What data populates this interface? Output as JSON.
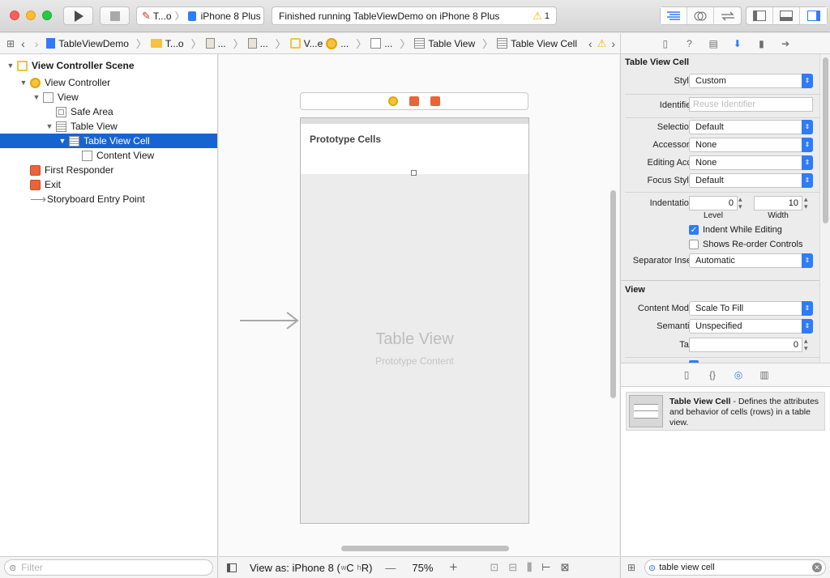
{
  "toolbar": {
    "scheme_target": "T...o",
    "scheme_device": "iPhone 8 Plus",
    "activity_text": "Finished running TableViewDemo on iPhone 8 Plus",
    "warning_count": "1"
  },
  "jumpbar": {
    "items": [
      "TableViewDemo",
      "T...o",
      "...",
      "...",
      "V...e",
      "...",
      "...",
      "Table View",
      "Table View Cell"
    ]
  },
  "navigator": {
    "scene": "View Controller Scene",
    "items": [
      {
        "label": "View Controller"
      },
      {
        "label": "View"
      },
      {
        "label": "Safe Area"
      },
      {
        "label": "Table View"
      },
      {
        "label": "Table View Cell"
      },
      {
        "label": "Content View"
      },
      {
        "label": "First Responder"
      },
      {
        "label": "Exit"
      },
      {
        "label": "Storyboard Entry Point"
      }
    ],
    "filter_placeholder": "Filter"
  },
  "canvas": {
    "prototype_cells": "Prototype Cells",
    "table_view_title": "Table View",
    "table_view_subtitle": "Prototype Content"
  },
  "canvas_bar": {
    "view_as": "View as: iPhone 8 (",
    "size_w": "w",
    "size_c": "C",
    "size_h": "h",
    "size_r": "R)",
    "minus": "—",
    "zoom": "75%",
    "plus": "+"
  },
  "inspector": {
    "cell_header": "Table View Cell",
    "style_label": "Style",
    "style_value": "Custom",
    "identifier_label": "Identifier",
    "identifier_placeholder": "Reuse Identifier",
    "selection_label": "Selection",
    "selection_value": "Default",
    "accessory_label": "Accessory",
    "accessory_value": "None",
    "editing_acc_label": "Editing Acc.",
    "editing_acc_value": "None",
    "focus_style_label": "Focus Style",
    "focus_style_value": "Default",
    "indentation_label": "Indentation",
    "indentation_level": "0",
    "indentation_width": "10",
    "level_label": "Level",
    "width_label": "Width",
    "indent_while_editing": "Indent While Editing",
    "indent_while_editing_checked": true,
    "shows_reorder": "Shows Re-order Controls",
    "shows_reorder_checked": false,
    "separator_inset_label": "Separator Inset",
    "separator_inset_value": "Automatic",
    "view_header": "View",
    "content_mode_label": "Content Mode",
    "content_mode_value": "Scale To Fill",
    "semantic_label": "Semantic",
    "semantic_value": "Unspecified",
    "tag_label": "Tag",
    "tag_value": "0"
  },
  "library": {
    "item_title": "Table View Cell",
    "item_desc": " - Defines the attributes and behavior of cells (rows) in a table view.",
    "filter_value": "table view cell"
  },
  "colors": {
    "selection": "#1764d1",
    "accent": "#2f7cf6",
    "warning": "#f5b400"
  }
}
